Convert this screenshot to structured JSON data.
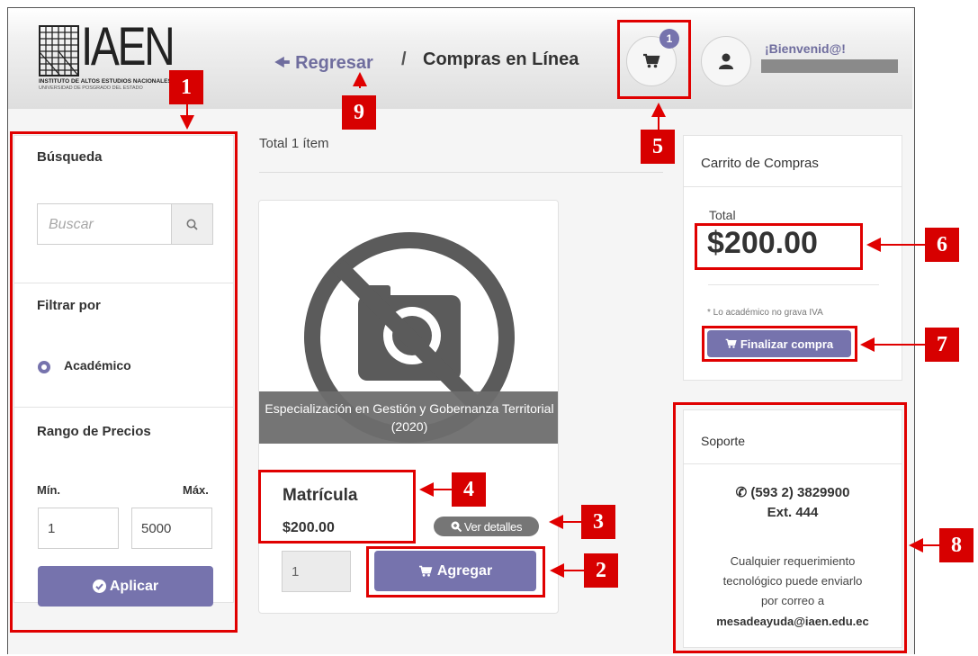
{
  "header": {
    "logo_text": "IAEN",
    "logo_subtitle_1": "INSTITUTO DE ALTOS ESTUDIOS NACIONALES",
    "logo_subtitle_2": "UNIVERSIDAD DE POSGRADO DEL ESTADO",
    "back_label": "Regresar",
    "separator": "/",
    "title": "Compras en Línea",
    "cart_count": "1",
    "welcome": "¡Bienvenid@!"
  },
  "sidebar": {
    "search_title": "Búsqueda",
    "search_placeholder": "Buscar",
    "filter_title": "Filtrar por",
    "filter_option": "Académico",
    "price_title": "Rango de Precios",
    "min_label": "Mín.",
    "max_label": "Máx.",
    "min_value": "1",
    "max_value": "5000",
    "apply_label": "Aplicar"
  },
  "main": {
    "total_items": "Total 1 ítem",
    "product": {
      "image_caption": "Especialización en Gestión y Gobernanza Territorial (2020)",
      "name": "Matrícula",
      "price": "$200.00",
      "details_label": "Ver detalles",
      "quantity": "1",
      "add_label": "Agregar"
    }
  },
  "cart": {
    "title": "Carrito de Compras",
    "total_label": "Total",
    "total_amount": "$200.00",
    "tax_note": "* Lo académico no grava IVA",
    "finish_label": "Finalizar compra"
  },
  "support": {
    "title": "Soporte",
    "phone": "(593 2) 3829900",
    "ext": "Ext. 444",
    "message_1": "Cualquier requerimiento",
    "message_2": "tecnológico puede enviarlo",
    "message_3": "por correo a",
    "email": "mesadeayuda@iaen.edu.ec"
  },
  "annotations": [
    "1",
    "2",
    "3",
    "4",
    "5",
    "6",
    "7",
    "8",
    "9"
  ],
  "colors": {
    "accent": "#7673ad",
    "annotation_red": "#d70000",
    "header_bg": "#dedede"
  }
}
